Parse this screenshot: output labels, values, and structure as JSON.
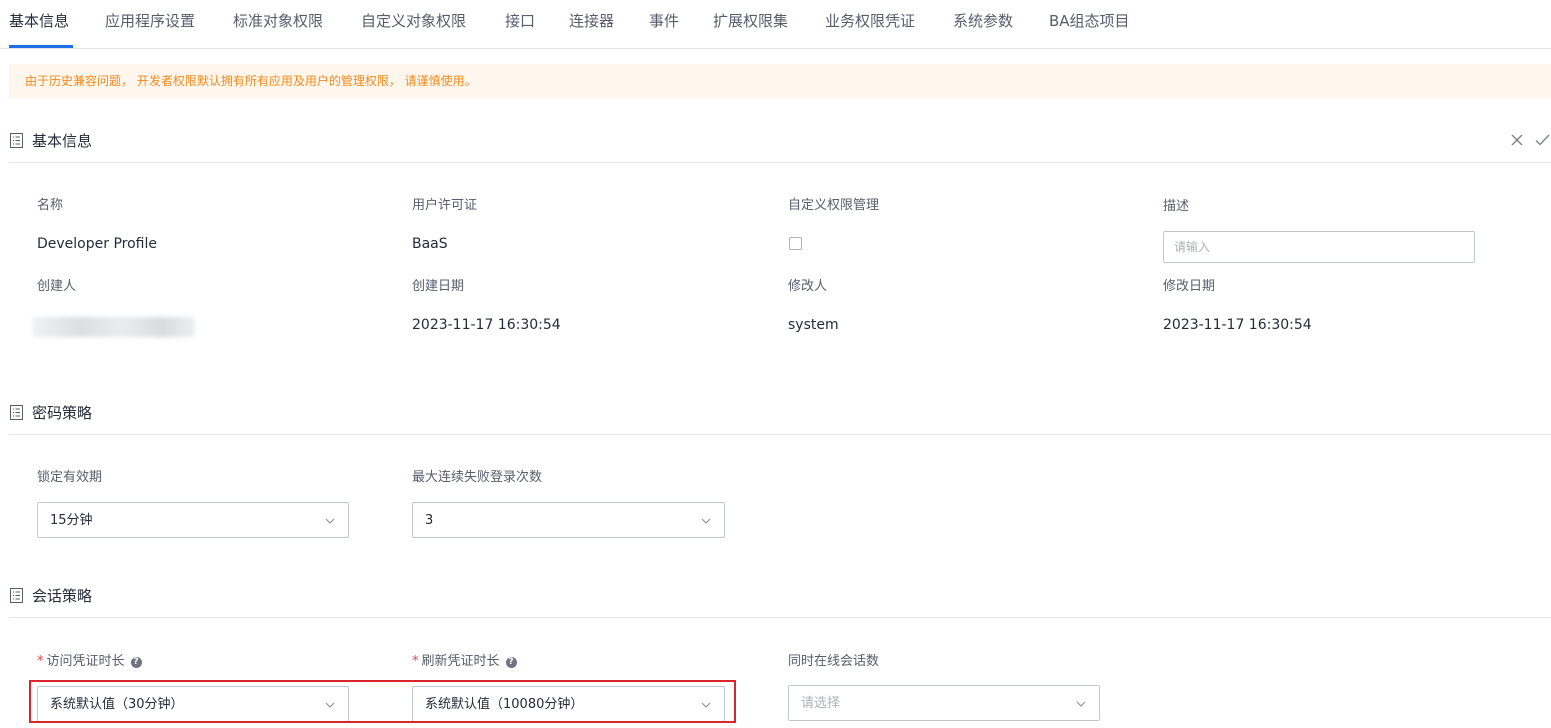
{
  "tabs": [
    {
      "label": "基本信息",
      "active": true
    },
    {
      "label": "应用程序设置"
    },
    {
      "label": "标准对象权限"
    },
    {
      "label": "自定义对象权限"
    },
    {
      "label": "接口"
    },
    {
      "label": "连接器"
    },
    {
      "label": "事件"
    },
    {
      "label": "扩展权限集"
    },
    {
      "label": "业务权限凭证"
    },
    {
      "label": "系统参数"
    },
    {
      "label": "BA组态项目"
    }
  ],
  "notice": "由于历史兼容问题， 开发者权限默认拥有所有应用及用户的管理权限， 请谨慎使用。",
  "colors": {
    "accent": "#1e6fe8",
    "warning_text": "#f08b1e",
    "warning_bg": "#fff7ee",
    "highlight": "#d9252b"
  },
  "basic_info": {
    "title": "基本信息",
    "actions": {
      "cancel_icon": "close-icon",
      "confirm_icon": "check-icon"
    },
    "fields": {
      "name": {
        "label": "名称",
        "value": "Developer Profile"
      },
      "user_license": {
        "label": "用户许可证",
        "value": "BaaS"
      },
      "custom_permission": {
        "label": "自定义权限管理",
        "checked": false
      },
      "description": {
        "label": "描述",
        "placeholder": "请输入",
        "value": ""
      },
      "creator": {
        "label": "创建人"
      },
      "created_date": {
        "label": "创建日期",
        "value": "2023-11-17 16:30:54"
      },
      "modifier": {
        "label": "修改人",
        "value": "system"
      },
      "modified_date": {
        "label": "修改日期",
        "value": "2023-11-17 16:30:54"
      }
    }
  },
  "password_policy": {
    "title": "密码策略",
    "lock_period": {
      "label": "锁定有效期",
      "value": "15分钟"
    },
    "max_failed_logins": {
      "label": "最大连续失败登录次数",
      "value": "3"
    }
  },
  "session_policy": {
    "title": "会话策略",
    "access_token_duration": {
      "label": "访问凭证时长",
      "required_mark": "*",
      "value": "系统默认值（30分钟）"
    },
    "refresh_token_duration": {
      "label": "刷新凭证时长",
      "required_mark": "*",
      "value": "系统默认值（10080分钟）"
    },
    "concurrent_sessions": {
      "label": "同时在线会话数",
      "placeholder": "请选择"
    }
  }
}
